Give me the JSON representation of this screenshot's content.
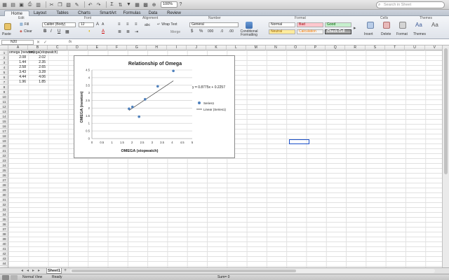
{
  "toolbar": {
    "zoom_value": "100%",
    "search_placeholder": "Search in Sheet"
  },
  "ribbon_tabs": [
    "Home",
    "Layout",
    "Tables",
    "Charts",
    "SmartArt",
    "Formulas",
    "Data",
    "Review"
  ],
  "ribbon": {
    "groups": {
      "edit": "Edit",
      "font": "Font",
      "alignment": "Alignment",
      "number": "Number",
      "format": "Format",
      "cells": "Cells",
      "themes": "Themes"
    },
    "paste_label": "Paste",
    "fill_label": "Fill",
    "clear_label": "Clear",
    "font_name": "Calibri (Body)",
    "font_size": "12",
    "wrap_text_label": "Wrap Text",
    "merge_label": "Merge",
    "abc_label": "abc",
    "number_format": "General",
    "cond_format_label": "Conditional Formatting",
    "styles": {
      "normal": "Normal",
      "bad": "Bad",
      "good": "Good",
      "neutral": "Neutral",
      "calculation": "Calculation",
      "check_cell": "Check Cell"
    },
    "insert_label": "Insert",
    "delete_label": "Delete",
    "format_label": "Format",
    "themes_label": "Themes",
    "aa_label": "Aa"
  },
  "formula_bar": {
    "name_box": "N20",
    "fx": "fx",
    "formula": ""
  },
  "columns": [
    "A",
    "B",
    "C",
    "D",
    "E",
    "F",
    "G",
    "H",
    "I",
    "J",
    "K",
    "L",
    "M",
    "N",
    "O",
    "P",
    "Q",
    "R",
    "S",
    "T",
    "U",
    "V"
  ],
  "rows": [
    "1",
    "2",
    "3",
    "4",
    "5",
    "6",
    "7",
    "8",
    "9",
    "10",
    "11",
    "12",
    "13",
    "14",
    "15",
    "16",
    "17",
    "18",
    "19",
    "20",
    "21",
    "22",
    "23",
    "24",
    "25",
    "26",
    "27",
    "28",
    "29",
    "30",
    "31",
    "32",
    "33",
    "34",
    "35",
    "36",
    "37",
    "38",
    "39",
    "40",
    "41",
    "42",
    "43",
    "44"
  ],
  "sheet_cells": {
    "A1": "omega (newton)",
    "B1": "omega(stopwatch)",
    "A2": "2.08",
    "B2": "2.02",
    "A3": "1.44",
    "B3": "2.35",
    "A4": "2.58",
    "B4": "2.65",
    "A5": "3.43",
    "B5": "3.28",
    "A6": "4.44",
    "B6": "4.06",
    "A7": "1.96",
    "B7": "1.85"
  },
  "sheet_tabs": [
    "Sheet1"
  ],
  "status": {
    "view": "Normal View",
    "ready": "Ready",
    "sum": "Sum= 0"
  },
  "chart_data": {
    "type": "scatter",
    "title": "Relationship of Omega",
    "xlabel": "OMEGA (stopwatch)",
    "ylabel": "OMEGA (newton)",
    "xlim": [
      0,
      5
    ],
    "ylim": [
      0,
      4.5
    ],
    "x_ticks": [
      "0",
      "0.5",
      "1",
      "1.5",
      "2",
      "2.5",
      "3",
      "3.5",
      "4",
      "4.5",
      "5"
    ],
    "y_ticks": [
      "0",
      "0.5",
      "1",
      "1.5",
      "2",
      "2.5",
      "3",
      "3.5",
      "4",
      "4.5"
    ],
    "grid": "horizontal",
    "legend": [
      "Series1",
      "Linear (Series1)"
    ],
    "legend_position": "right",
    "trendline_equation": "y = 0.8775x + 0.2257",
    "trendline": {
      "slope": 0.8775,
      "intercept": 0.2257
    },
    "series": [
      {
        "name": "Series1",
        "x": [
          2.02,
          2.35,
          2.65,
          3.28,
          4.06,
          1.85
        ],
        "y": [
          2.08,
          1.44,
          2.58,
          3.43,
          4.44,
          1.96
        ],
        "color": "#4f81bd"
      }
    ]
  }
}
